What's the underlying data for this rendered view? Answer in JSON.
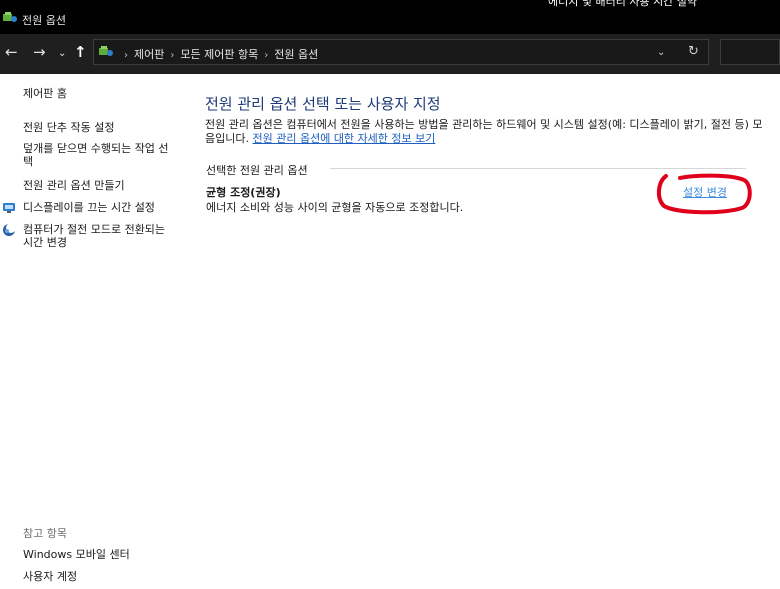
{
  "window": {
    "title": "전원 옵션",
    "overflow_text": "에너지 및 배터리 사용 시간 절약"
  },
  "navbar": {
    "back": "←",
    "forward": "→",
    "recent": "⌄",
    "up": "↑",
    "breadcrumbs": [
      "제어판",
      "모든 제어판 항목",
      "전원 옵션"
    ],
    "dropdown": "⌄",
    "refresh": "↻"
  },
  "sidebar": {
    "home": "제어판 홈",
    "items": [
      {
        "label": "전원 단추 작동 설정"
      },
      {
        "label": "덮개를 닫으면 수행되는 작업 선택"
      },
      {
        "label": "전원 관리 옵션 만들기"
      },
      {
        "label": "디스플레이를 끄는 시간 설정"
      },
      {
        "label": "컴퓨터가 절전 모드로 전환되는 시간 변경"
      }
    ],
    "see_also": "참고 항목",
    "see_also_items": [
      "Windows 모바일 센터",
      "사용자 계정"
    ]
  },
  "main": {
    "title": "전원 관리 옵션 선택 또는 사용자 지정",
    "description": "전원 관리 옵션은 컴퓨터에서 전원을 사용하는 방법을 관리하는 하드웨어 및 시스템 설정(예: 디스플레이 밝기, 절전 등) 모음입니다. ",
    "learn_more_link": "전원 관리 옵션에 대한 자세한 정보 보기",
    "group_label": "선택한 전원 관리 옵션",
    "plan_name": "균형 조정(권장)",
    "plan_description": "에너지 소비와 성능 사이의 균형을 자동으로 조정합니다.",
    "change_link": "설정 변경"
  },
  "colors": {
    "title": "#1e3a78",
    "link": "#1f5fbf",
    "annotation": "#e0001b"
  }
}
